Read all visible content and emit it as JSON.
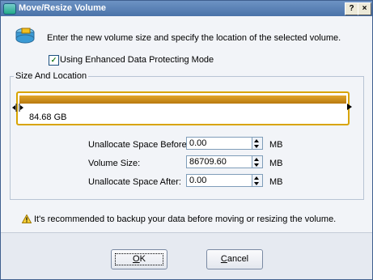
{
  "window": {
    "title": "Move/Resize Volume",
    "help_button": "?",
    "close_button": "×"
  },
  "intro": {
    "text": "Enter the new volume size and specify the location of the selected volume."
  },
  "protect_mode": {
    "label": "Using Enhanced Data Protecting Mode",
    "checked": true,
    "check_glyph": "✓"
  },
  "size_location": {
    "group_label": "Size And Location",
    "partition_size": "84.68 GB",
    "fields": [
      {
        "label": "Unallocate Space Before:",
        "value": "0.00",
        "unit": "MB"
      },
      {
        "label": "Volume Size:",
        "value": "86709.60",
        "unit": "MB"
      },
      {
        "label": "Unallocate Space After:",
        "value": "0.00",
        "unit": "MB"
      }
    ]
  },
  "warning": {
    "text": "It's recommended to backup your data before moving or resizing the volume."
  },
  "buttons": {
    "ok_mnemonic": "O",
    "ok_rest": "K",
    "cancel_mnemonic": "C",
    "cancel_rest": "ancel"
  },
  "colors": {
    "titlebar": "#4a72a8",
    "partition_bar": "#d8a400",
    "dialog_bg": "#f2f4f8"
  }
}
